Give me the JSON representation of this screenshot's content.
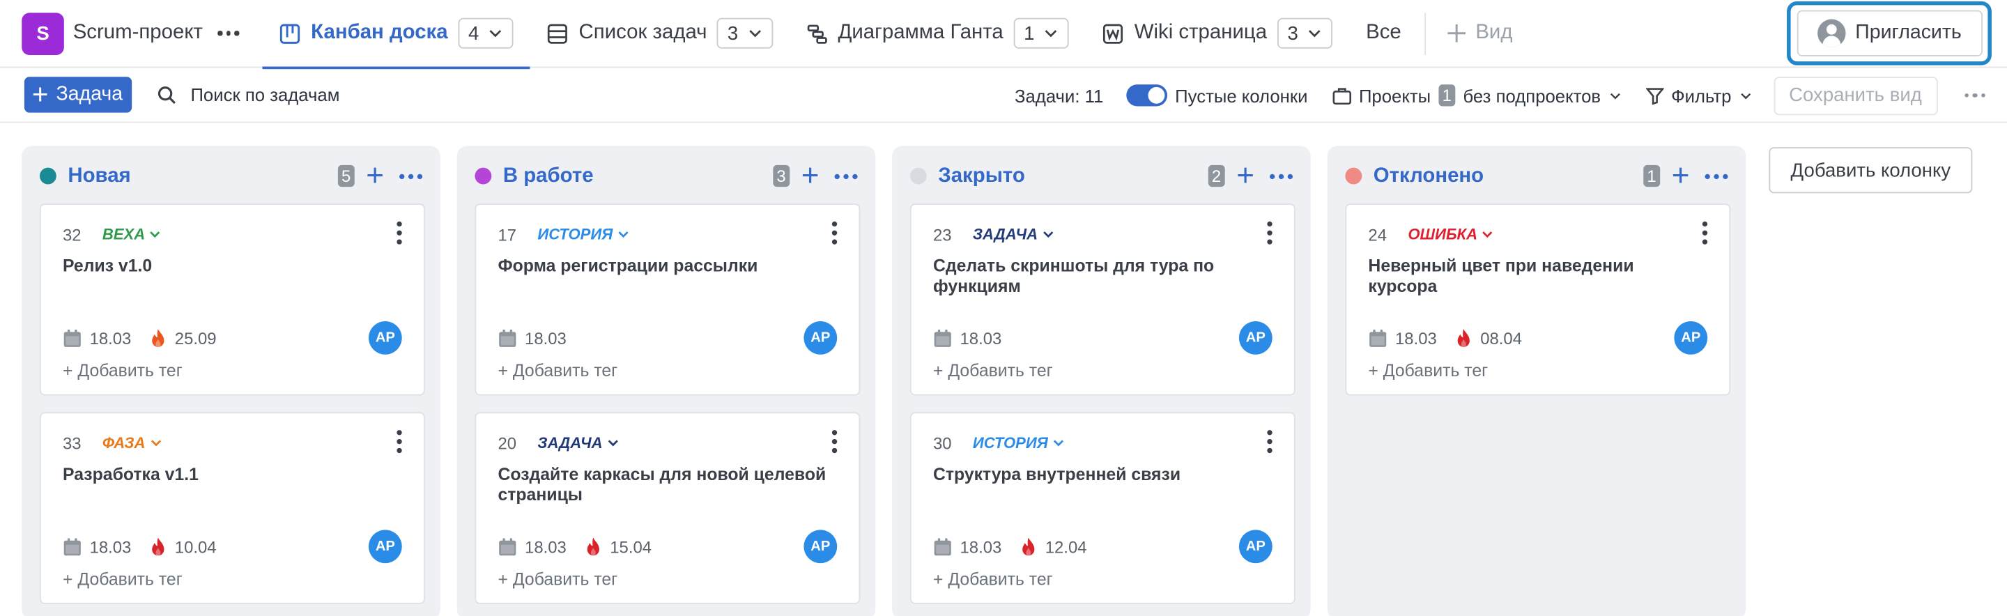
{
  "project": {
    "logo": "S",
    "name": "Scrum-проект"
  },
  "tabs": [
    {
      "label": "Канбан доска",
      "count": "4",
      "icon": "kanban-icon"
    },
    {
      "label": "Список задач",
      "count": "3",
      "icon": "list-icon"
    },
    {
      "label": "Диаграмма Ганта",
      "count": "1",
      "icon": "gantt-icon"
    },
    {
      "label": "Wiki страница",
      "count": "3",
      "icon": "wiki-icon"
    }
  ],
  "all_label": "Все",
  "add_view_label": "Вид",
  "invite_label": "Пригласить",
  "toolbar": {
    "add_task_label": "Задача",
    "search_placeholder": "Поиск по задачам",
    "tasks_count": "Задачи: 11",
    "empty_columns_label": "Пустые колонки",
    "projects_label": "Проекты",
    "projects_badge": "1",
    "subprojects_label": "без подпроектов",
    "filter_label": "Фильтр",
    "save_view_label": "Сохранить вид"
  },
  "colors": {
    "accent": "#3468c9",
    "milestone": "#2e9a4a",
    "story": "#2b8ce8",
    "task": "#213a78",
    "phase": "#e97a1c",
    "bug": "#e0202e",
    "fire_orange": "#e7571e",
    "fire_red": "#d8232a"
  },
  "columns": [
    {
      "title": "Новая",
      "count": "5",
      "dot": "#1a8a94",
      "cards": [
        {
          "num": "32",
          "type": "ВЕХА",
          "type_color": "#2e9a4a",
          "title": "Релиз v1.0",
          "start": "18.03",
          "due": "25.09",
          "fire": "#e7571e",
          "assignee": "AP",
          "add_tag": "+ Добавить тег"
        },
        {
          "num": "33",
          "type": "ФАЗА",
          "type_color": "#e97a1c",
          "title": "Разработка v1.1",
          "start": "18.03",
          "due": "10.04",
          "fire": "#d8232a",
          "assignee": "AP",
          "add_tag": "+ Добавить тег"
        }
      ]
    },
    {
      "title": "В работе",
      "count": "3",
      "dot": "#b545d6",
      "cards": [
        {
          "num": "17",
          "type": "ИСТОРИЯ",
          "type_color": "#2b8ce8",
          "title": "Форма регистрации рассылки",
          "start": "18.03",
          "due": "",
          "fire": "",
          "assignee": "AP",
          "add_tag": "+ Добавить тег"
        },
        {
          "num": "20",
          "type": "ЗАДАЧА",
          "type_color": "#213a78",
          "title": "Создайте каркасы для новой целевой страницы",
          "start": "18.03",
          "due": "15.04",
          "fire": "#d8232a",
          "assignee": "AP",
          "add_tag": "+ Добавить тег"
        }
      ]
    },
    {
      "title": "Закрыто",
      "count": "2",
      "dot": "#d8dbdf",
      "cards": [
        {
          "num": "23",
          "type": "ЗАДАЧА",
          "type_color": "#213a78",
          "title": "Сделать скриншоты для тура по функциям",
          "start": "18.03",
          "due": "",
          "fire": "",
          "assignee": "AP",
          "add_tag": "+ Добавить тег"
        },
        {
          "num": "30",
          "type": "ИСТОРИЯ",
          "type_color": "#2b8ce8",
          "title": "Структура внутренней связи",
          "start": "18.03",
          "due": "12.04",
          "fire": "#d8232a",
          "assignee": "AP",
          "add_tag": "+ Добавить тег"
        }
      ]
    },
    {
      "title": "Отклонено",
      "count": "1",
      "dot": "#f08a84",
      "cards": [
        {
          "num": "24",
          "type": "ОШИБКА",
          "type_color": "#e0202e",
          "title": "Неверный цвет при наведении курсора",
          "start": "18.03",
          "due": "08.04",
          "fire": "#d8232a",
          "assignee": "AP",
          "add_tag": "+ Добавить тег"
        }
      ]
    }
  ],
  "add_column_label": "Добавить колонку"
}
